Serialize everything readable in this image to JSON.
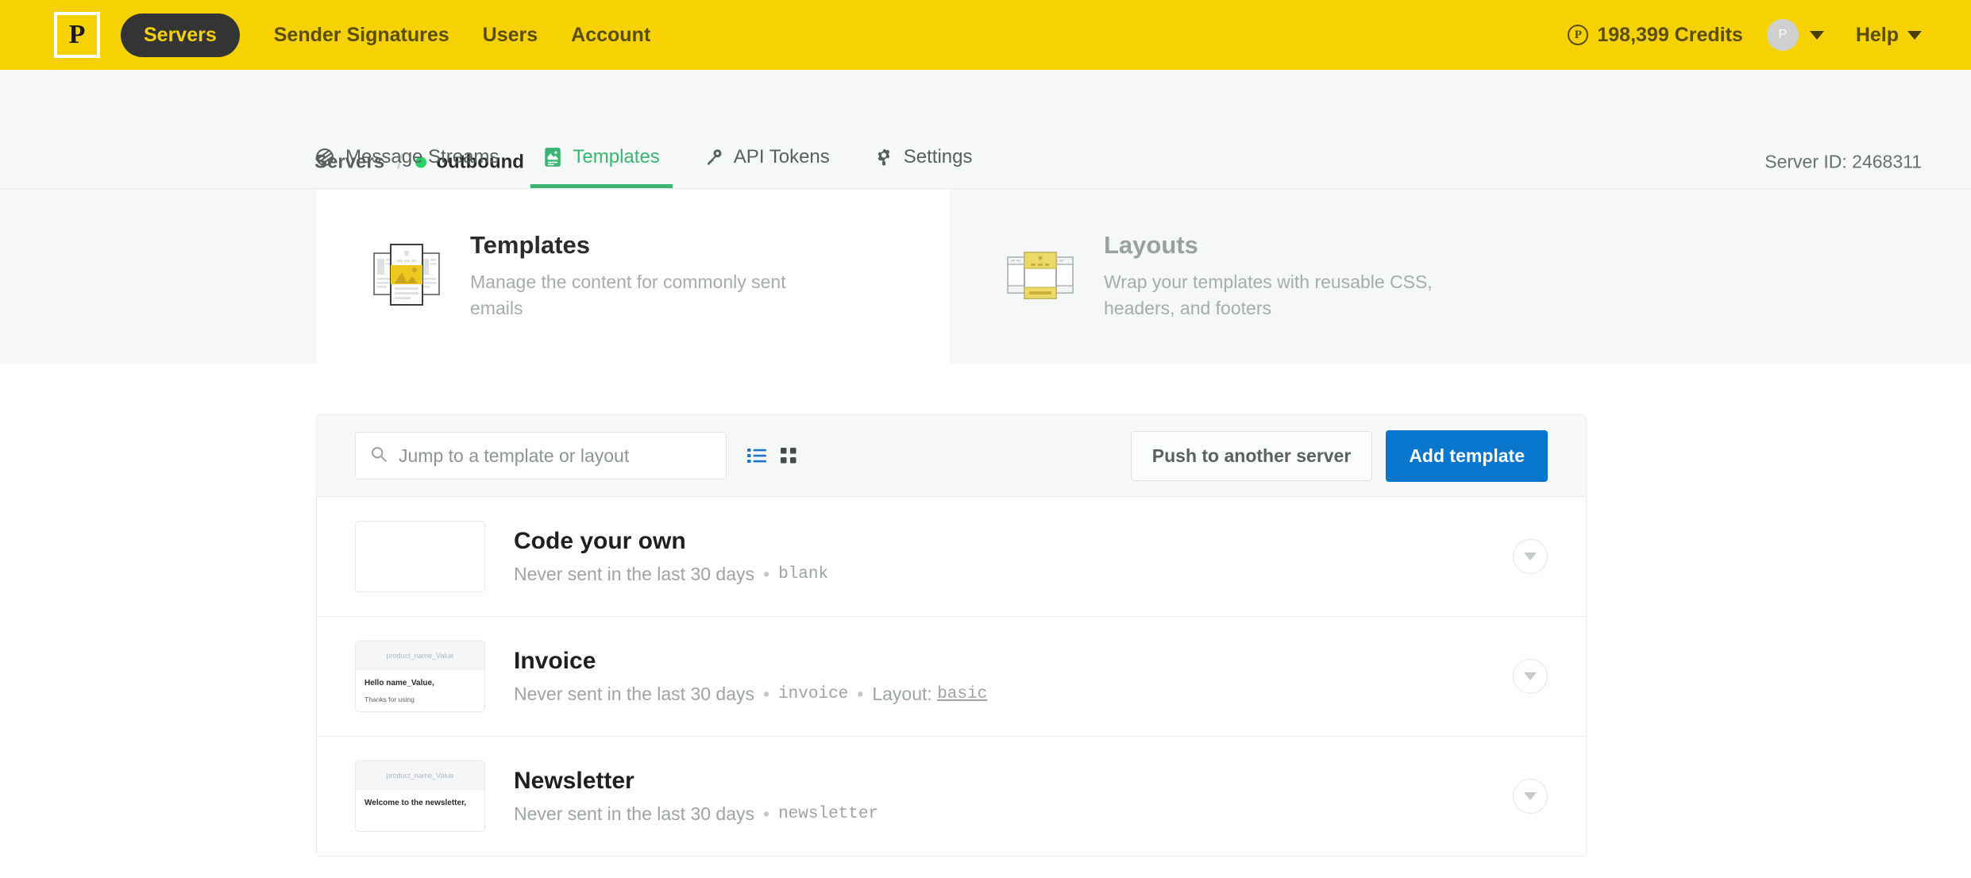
{
  "topnav": {
    "logo_letter": "P",
    "primary_item": "Servers",
    "links": [
      "Sender Signatures",
      "Users",
      "Account"
    ],
    "credits_symbol": "P",
    "credits": "198,399 Credits",
    "avatar_letter": "P",
    "help": "Help",
    "bar_color": "#f6d205",
    "pill_color": "#343434"
  },
  "breadcrumb": {
    "parent": "Servers",
    "separator": "/",
    "current": "outbound",
    "status_color": "#25d366"
  },
  "server_id_label": "Server ID: 2468311",
  "tabs": [
    {
      "label": "Message Streams",
      "icon": "streams-icon",
      "active": false
    },
    {
      "label": "Templates",
      "icon": "template-icon",
      "active": true
    },
    {
      "label": "API Tokens",
      "icon": "key-icon",
      "active": false
    },
    {
      "label": "Settings",
      "icon": "gear-icon",
      "active": false
    }
  ],
  "mode_cards": [
    {
      "title": "Templates",
      "description": "Manage the content for commonly sent emails",
      "active": true,
      "icon": "templates-stack-icon"
    },
    {
      "title": "Layouts",
      "description": "Wrap your templates with reusable CSS, headers, and footers",
      "active": false,
      "icon": "layouts-stack-icon"
    }
  ],
  "toolbar": {
    "search_placeholder": "Jump to a template or layout",
    "search_value": "",
    "search_icon": "search-icon",
    "view_list_icon": "list-view-icon",
    "view_grid_icon": "grid-view-icon",
    "view_list_active": true,
    "push_button": "Push to another server",
    "add_button": "Add template",
    "add_button_color": "#0976cd"
  },
  "templates": [
    {
      "name": "Code your own",
      "sent_text": "Never sent in the last 30 days",
      "alias": "blank",
      "layout_label": "",
      "layout_name": "",
      "thumb": {
        "has_preview": false,
        "head": "",
        "line1": "",
        "line2": ""
      }
    },
    {
      "name": "Invoice",
      "sent_text": "Never sent in the last 30 days",
      "alias": "invoice",
      "layout_label": "Layout:",
      "layout_name": "basic",
      "thumb": {
        "has_preview": true,
        "head": "product_name_Value",
        "line1": "Hello name_Value,",
        "line2": "Thanks for using"
      }
    },
    {
      "name": "Newsletter",
      "sent_text": "Never sent in the last 30 days",
      "alias": "newsletter",
      "layout_label": "",
      "layout_name": "",
      "thumb": {
        "has_preview": true,
        "head": "product_name_Value",
        "line1": "Welcome to the newsletter,",
        "line2": ""
      }
    }
  ],
  "symbols": {
    "bullet": "•"
  }
}
